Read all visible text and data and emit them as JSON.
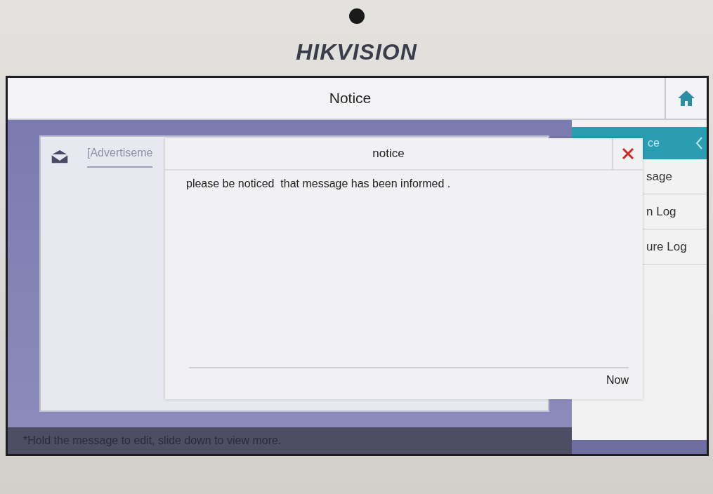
{
  "device": {
    "brand_logo": "HIKVISION"
  },
  "header": {
    "title": "Notice"
  },
  "message_list": {
    "items": [
      "[Advertiseme"
    ],
    "hint": "*Hold the message to edit, slide down to view more."
  },
  "sidebar": {
    "title": "ce",
    "items": [
      "sage",
      "n Log",
      "ure Log"
    ]
  },
  "dialog": {
    "title": "notice",
    "message": "please be noticed  that message has been informed .",
    "time": "Now"
  }
}
